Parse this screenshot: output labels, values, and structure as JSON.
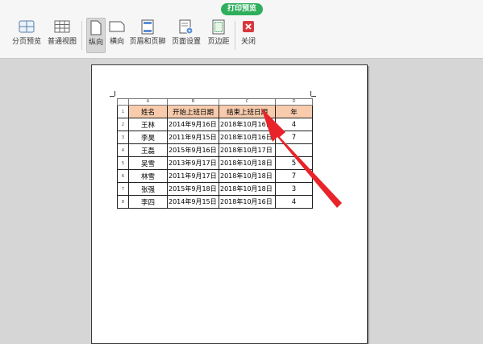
{
  "ribbon": {
    "tab_title": "打印预览",
    "tools": [
      {
        "label": "分页预览"
      },
      {
        "label": "普通视图"
      },
      {
        "label": "纵向"
      },
      {
        "label": "横向"
      },
      {
        "label": "页眉和页脚"
      },
      {
        "label": "页面设置"
      },
      {
        "label": "页边距"
      },
      {
        "label": "关闭"
      }
    ],
    "colors": {
      "badge": "#2fae5c",
      "close": "#d9393e",
      "accent": "#3a7dc9"
    }
  },
  "sheet": {
    "col_letters": [
      "A",
      "B",
      "C",
      "D"
    ],
    "headers": [
      "姓名",
      "开始上班日期",
      "结束上班日期",
      "年"
    ],
    "rows": [
      {
        "num": "1"
      },
      {
        "num": "2",
        "name": "王林",
        "start": "2014年9月16日",
        "end": "2018年10月16日",
        "years": "4"
      },
      {
        "num": "3",
        "name": "李昊",
        "start": "2011年9月15日",
        "end": "2018年10月16日",
        "years": "7"
      },
      {
        "num": "4",
        "name": "王磊",
        "start": "2015年9月16日",
        "end": "2018年10月17日",
        "years": ""
      },
      {
        "num": "5",
        "name": "吴雪",
        "start": "2013年9月17日",
        "end": "2018年10月18日",
        "years": "5"
      },
      {
        "num": "6",
        "name": "林雪",
        "start": "2011年9月17日",
        "end": "2018年10月18日",
        "years": "7"
      },
      {
        "num": "7",
        "name": "张强",
        "start": "2015年9月18日",
        "end": "2018年10月18日",
        "years": "3"
      },
      {
        "num": "8",
        "name": "李四",
        "start": "2014年9月15日",
        "end": "2018年10月16日",
        "years": "4"
      }
    ],
    "header_fill": "#f8cbad"
  },
  "annotation": {
    "arrow_color": "#e8242a"
  }
}
